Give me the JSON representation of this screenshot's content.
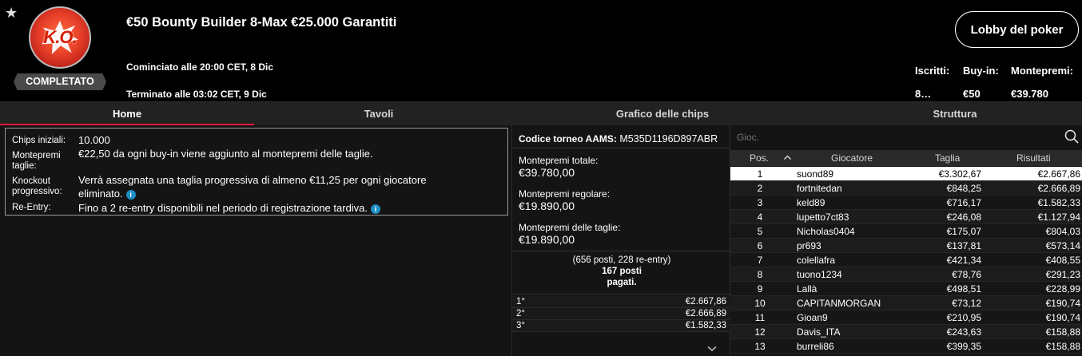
{
  "header": {
    "logo_text": "K.O.",
    "status_badge": "COMPLETATO",
    "title": "€50 Bounty Builder 8-Max €25.000 Garantiti",
    "started": "Cominciato alle 20:00 CET, 8 Dic",
    "ended": "Terminato alle 03:02 CET, 9 Dic",
    "lobby_button": "Lobby del poker",
    "stats": [
      {
        "label": "Iscritti:",
        "value": "8…"
      },
      {
        "label": "Buy-in:",
        "value": "€50"
      },
      {
        "label": "Montepremi:",
        "value": "€39.780"
      }
    ]
  },
  "tabs": [
    {
      "label": "Home",
      "active": true
    },
    {
      "label": "Tavoli",
      "active": false
    },
    {
      "label": "Grafico delle chips",
      "active": false
    },
    {
      "label": "Struttura",
      "active": false
    }
  ],
  "info": {
    "chips_label": "Chips iniziali:",
    "chips_value": "10.000",
    "bounty_pool_label": "Montepremi taglie:",
    "bounty_pool_value": "€22,50 da ogni buy-in viene aggiunto al montepremi delle taglie.",
    "knockout_label": "Knockout progressivo:",
    "knockout_value": "Verrà assegnata una taglia progressiva di almeno €11,25 per ogni giocatore eliminato.",
    "reentry_label": "Re-Entry:",
    "reentry_value": "Fino a 2 re-entry disponibili nel periodo di registrazione tardiva."
  },
  "prize": {
    "aams_label": "Codice torneo AAMS:",
    "aams_code": "M535D1196D897ABR",
    "total_label": "Montepremi totale:",
    "total_value": "€39.780,00",
    "regular_label": "Montepremi regolare:",
    "regular_value": "€19.890,00",
    "bounty_label": "Montepremi delle taglie:",
    "bounty_value": "€19.890,00",
    "seats_line1": "(656 posti, 228 re-entry)",
    "seats_line2": "167 posti",
    "seats_line3": "pagati.",
    "payouts": [
      {
        "pos": "1°",
        "amount": "€2.667,86"
      },
      {
        "pos": "2°",
        "amount": "€2.666,89"
      },
      {
        "pos": "3°",
        "amount": "€1.582,33"
      }
    ]
  },
  "players": {
    "search_placeholder": "Gioc.",
    "columns": {
      "pos": "Pos.",
      "player": "Giocatore",
      "bounty": "Taglia",
      "result": "Risultati"
    },
    "rows": [
      {
        "pos": "1",
        "name": "suond89",
        "bounty": "€3.302,67",
        "result": "€2.667,86"
      },
      {
        "pos": "2",
        "name": "fortnitedan",
        "bounty": "€848,25",
        "result": "€2.666,89"
      },
      {
        "pos": "3",
        "name": "keld89",
        "bounty": "€716,17",
        "result": "€1.582,33"
      },
      {
        "pos": "4",
        "name": "lupetto7ct83",
        "bounty": "€246,08",
        "result": "€1.127,94"
      },
      {
        "pos": "5",
        "name": "Nicholas0404",
        "bounty": "€175,07",
        "result": "€804,03"
      },
      {
        "pos": "6",
        "name": "pr693",
        "bounty": "€137,81",
        "result": "€573,14"
      },
      {
        "pos": "7",
        "name": "colellafra",
        "bounty": "€421,34",
        "result": "€408,55"
      },
      {
        "pos": "8",
        "name": "tuono1234",
        "bounty": "€78,76",
        "result": "€291,23"
      },
      {
        "pos": "9",
        "name": "Lallà",
        "bounty": "€498,51",
        "result": "€228,99"
      },
      {
        "pos": "10",
        "name": "CAPITANMORGAN",
        "bounty": "€73,12",
        "result": "€190,74"
      },
      {
        "pos": "11",
        "name": "Gioan9",
        "bounty": "€210,95",
        "result": "€190,74"
      },
      {
        "pos": "12",
        "name": "Davis_ITA",
        "bounty": "€243,63",
        "result": "€158,88"
      },
      {
        "pos": "13",
        "name": "burreli86",
        "bounty": "€399,35",
        "result": "€158,88"
      }
    ]
  },
  "colors": {
    "accent": "#e0183c",
    "info_icon": "#1e8fc6"
  }
}
